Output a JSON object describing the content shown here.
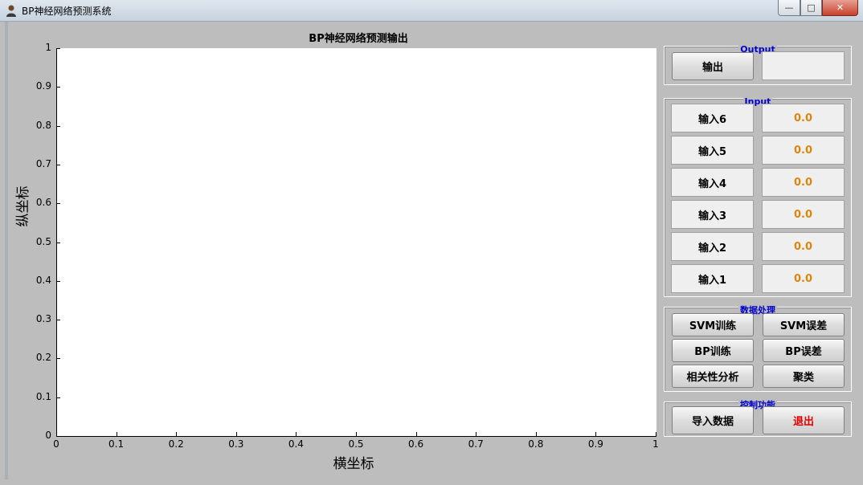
{
  "window": {
    "title": "BP神经网络预测系统"
  },
  "plot": {
    "title": "BP神经网络预测输出",
    "xlabel": "横坐标",
    "ylabel": "纵坐标",
    "yticks": [
      "0",
      "0.1",
      "0.2",
      "0.3",
      "0.4",
      "0.5",
      "0.6",
      "0.7",
      "0.8",
      "0.9",
      "1"
    ],
    "xticks": [
      "0",
      "0.1",
      "0.2",
      "0.3",
      "0.4",
      "0.5",
      "0.6",
      "0.7",
      "0.8",
      "0.9",
      "1"
    ]
  },
  "chart_data": {
    "type": "line",
    "title": "BP神经网络预测输出",
    "xlabel": "横坐标",
    "ylabel": "纵坐标",
    "xlim": [
      0,
      1
    ],
    "ylim": [
      0,
      1
    ],
    "series": []
  },
  "output": {
    "title": "Output",
    "button_label": "输出",
    "value": ""
  },
  "input": {
    "title": "Input",
    "rows": [
      {
        "label": "输入6",
        "value": "0.0"
      },
      {
        "label": "输入5",
        "value": "0.0"
      },
      {
        "label": "输入4",
        "value": "0.0"
      },
      {
        "label": "输入3",
        "value": "0.0"
      },
      {
        "label": "输入2",
        "value": "0.0"
      },
      {
        "label": "输入1",
        "value": "0.0"
      }
    ]
  },
  "data_processing": {
    "title": "数据处理",
    "buttons": [
      "SVM训练",
      "SVM误差",
      "BP训练",
      "BP误差",
      "相关性分析",
      "聚类"
    ]
  },
  "control": {
    "title": "控制功能",
    "import_label": "导入数据",
    "exit_label": "退出"
  },
  "colors": {
    "value_text": "#d9860e",
    "group_title": "#0000cc",
    "exit_text": "#e00000"
  }
}
